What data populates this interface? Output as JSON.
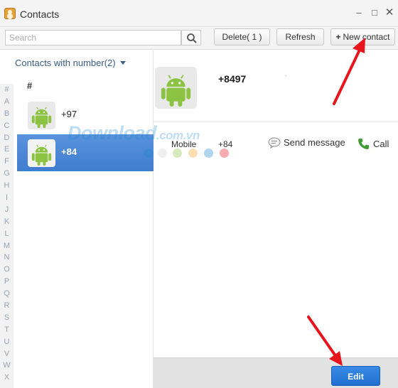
{
  "window": {
    "title": "Contacts"
  },
  "toolbar": {
    "search_placeholder": "Search",
    "delete_label": "Delete( 1 )",
    "refresh_label": "Refresh",
    "new_contact_plus": "+",
    "new_contact_label": "New contact"
  },
  "sidebar": {
    "filter_label": "Contacts with number(2)",
    "alphabet": [
      "#",
      "A",
      "B",
      "C",
      "D",
      "E",
      "F",
      "G",
      "H",
      "I",
      "J",
      "K",
      "L",
      "M",
      "N",
      "O",
      "P",
      "Q",
      "R",
      "S",
      "T",
      "U",
      "V",
      "W",
      "X"
    ],
    "group_header": "#",
    "contacts": [
      {
        "number": "+97",
        "selected": false
      },
      {
        "number": "+84",
        "selected": true
      }
    ]
  },
  "detail": {
    "number": "+8497",
    "phone_type": "Mobile",
    "phone_value": "+84",
    "send_message_label": "Send message",
    "call_label": "Call",
    "edit_label": "Edit"
  },
  "watermark": {
    "main": "Download",
    "suffix": ".com.vn"
  },
  "colors": {
    "selected_row": "#4a87d6",
    "edit_button": "#2a7ddb",
    "link_blue": "#3a5d84",
    "arrow_red": "#e8141b",
    "android_green": "#8cc342",
    "dots": [
      "#1e88d2",
      "#d0d0d0",
      "#8cc342",
      "#f5a623",
      "#1e88d2",
      "#e8141b"
    ]
  }
}
